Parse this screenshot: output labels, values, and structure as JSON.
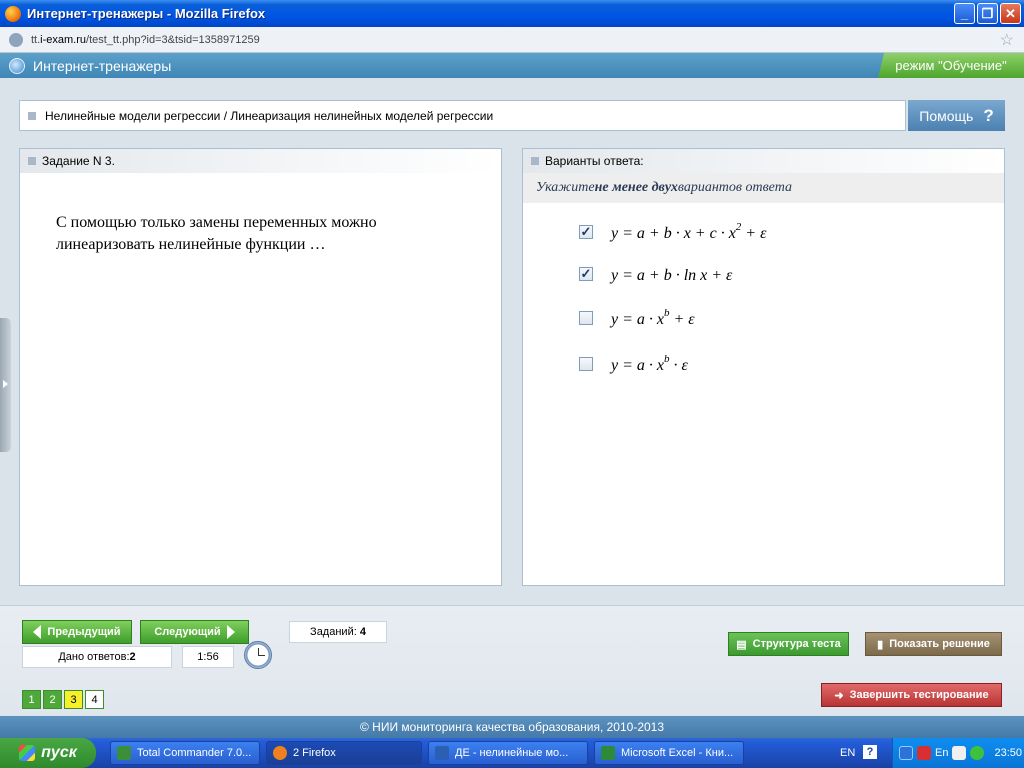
{
  "window": {
    "title": "Интернет-тренажеры - Mozilla Firefox"
  },
  "address": {
    "url_prefix": "tt.",
    "url_domain": "i-exam.ru",
    "url_path": "/test_tt.php?id=3&tsid=1358971259"
  },
  "app": {
    "title": "Интернет-тренажеры",
    "mode": "режим \"Обучение\""
  },
  "breadcrumb": {
    "text": "Нелинейные модели регрессии / Линеаризация нелинейных моделей регрессии"
  },
  "help": {
    "label": "Помощь",
    "icon": "?"
  },
  "task": {
    "header": "Задание N 3.",
    "question": "С помощью только замены переменных можно линеаризовать нелинейные функции …"
  },
  "answers": {
    "header": "Варианты ответа:",
    "hint_pre": "Укажите ",
    "hint_bold": "не менее двух",
    "hint_post": " вариантов ответа",
    "options": [
      {
        "checked": true,
        "f1": "y = a + b · x + c · x",
        "sup": "2",
        "f2": " + ε"
      },
      {
        "checked": true,
        "f1": "y = a + b · ln x + ε",
        "sup": "",
        "f2": ""
      },
      {
        "checked": false,
        "f1": "y = a · x",
        "sup": "b",
        "f2": " + ε"
      },
      {
        "checked": false,
        "f1": "y = a · x",
        "sup": "b",
        "f2": " · ε"
      }
    ]
  },
  "nav": {
    "prev": "Предыдущий",
    "next": "Следующий",
    "tasks_label": "Заданий:",
    "tasks_count": "4",
    "answers_label": "Дано ответов:",
    "answers_count": "2",
    "timer": "1:56",
    "structure": "Структура теста",
    "show_solution": "Показать решение",
    "finish": "Завершить тестирование",
    "pages": [
      "1",
      "2",
      "3",
      "4"
    ],
    "current_page": "3"
  },
  "footer": {
    "text": "© НИИ мониторинга качества образования, 2010-2013"
  },
  "taskbar": {
    "start": "пуск",
    "tasks": [
      "Total Commander 7.0...",
      "2 Firefox",
      "ДЕ - нелинейные мо...",
      "Microsoft Excel - Кни..."
    ],
    "lang": "EN",
    "tray_lang": "En",
    "clock": "23:50"
  }
}
